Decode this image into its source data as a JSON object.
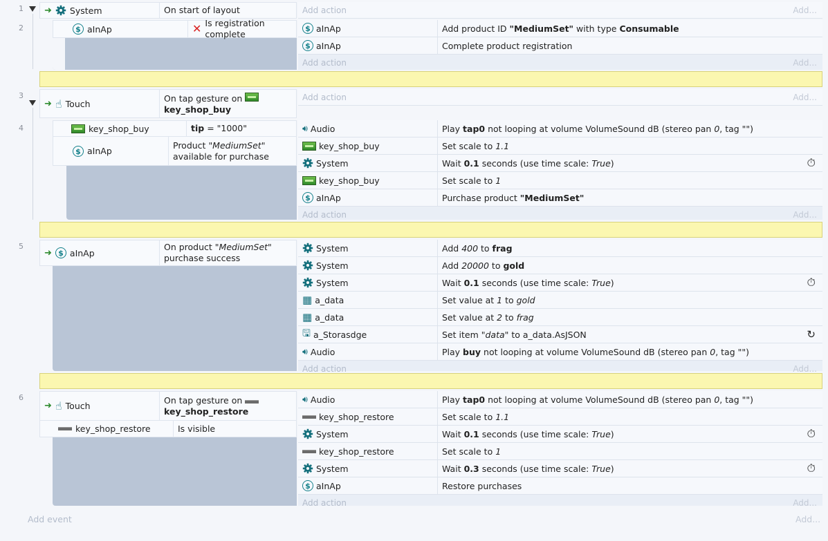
{
  "ui": {
    "add_action": "Add action",
    "add_short": "Add...",
    "add_event": "Add event",
    "timer_icon": "stopwatch-icon",
    "loop_icon": "refresh-icon"
  },
  "events": [
    {
      "num": "1",
      "obj": "System",
      "cond": "On start of layout"
    },
    {
      "num": "2",
      "sub": {
        "obj": "aInAp",
        "cond": "Is registration complete"
      },
      "actions": [
        {
          "obj": "aInAp",
          "pre": "Add product ID ",
          "b1": "\"MediumSet\"",
          "mid": " with type ",
          "b2": "Consumable"
        },
        {
          "obj": "aInAp",
          "text": "Complete product registration"
        }
      ]
    },
    {
      "num": "3",
      "obj": "Touch",
      "cond_pre": "On tap gesture on",
      "cond_obj": "key_shop_buy"
    },
    {
      "num": "4",
      "conds": [
        {
          "obj": "key_shop_buy",
          "b": "tip",
          "rest": " = \"1000\""
        },
        {
          "obj": "aInAp",
          "l1_pre": "Product ",
          "l1_i": "\"MediumSet\"",
          "l2": "available for purchase"
        }
      ],
      "actions": [
        {
          "obj": "Audio",
          "p1": "Play ",
          "b1": "tap0",
          "p2": " not looping at volume VolumeSound dB (stereo pan ",
          "i1": "0",
          "p3": ", tag \"\")"
        },
        {
          "obj": "key_shop_buy",
          "p1": "Set scale to ",
          "i1": "1.1"
        },
        {
          "obj": "System",
          "p1": "Wait ",
          "b1": "0.1",
          "p2": " seconds (use time scale: ",
          "i1": "True",
          "p3": ")"
        },
        {
          "obj": "key_shop_buy",
          "p1": "Set scale to ",
          "i1": "1"
        },
        {
          "obj": "aInAp",
          "p1": "Purchase product ",
          "b1": "\"MediumSet\""
        }
      ]
    },
    {
      "num": "5",
      "obj": "aInAp",
      "l1_pre": "On product ",
      "l1_i": "\"MediumSet\"",
      "l2": "purchase success",
      "actions": [
        {
          "obj": "System",
          "p1": "Add ",
          "i1": "400",
          "p2": " to ",
          "b1": "frag"
        },
        {
          "obj": "System",
          "p1": "Add ",
          "i1": "20000",
          "p2": " to ",
          "b1": "gold"
        },
        {
          "obj": "System",
          "p1": "Wait ",
          "b1": "0.1",
          "p2": " seconds (use time scale: ",
          "i1": "True",
          "p3": ")"
        },
        {
          "obj": "a_data",
          "p1": "Set value at ",
          "i1": "1",
          "p2": " to ",
          "i2": "gold"
        },
        {
          "obj": "a_data",
          "p1": "Set value at ",
          "i1": "2",
          "p2": " to ",
          "i2": "frag"
        },
        {
          "obj": "a_Storasdge",
          "p1": "Set item ",
          "i1": "\"data\"",
          "p2": " to a_data.AsJSON"
        },
        {
          "obj": "Audio",
          "p1": "Play ",
          "b1": "buy",
          "p2": " not looping at volume VolumeSound dB (stereo pan ",
          "i1": "0",
          "p3": ", tag \"\")"
        }
      ]
    },
    {
      "num": "6",
      "obj": "Touch",
      "cond_pre": "On tap gesture on",
      "cond_obj": "key_shop_restore",
      "cond2_obj": "key_shop_restore",
      "cond2": "Is visible",
      "actions": [
        {
          "obj": "Audio",
          "p1": "Play ",
          "b1": "tap0",
          "p2": " not looping at volume VolumeSound dB (stereo pan ",
          "i1": "0",
          "p3": ", tag \"\")"
        },
        {
          "obj": "key_shop_restore",
          "p1": "Set scale to ",
          "i1": "1.1"
        },
        {
          "obj": "System",
          "p1": "Wait ",
          "b1": "0.1",
          "p2": " seconds (use time scale: ",
          "i1": "True",
          "p3": ")"
        },
        {
          "obj": "key_shop_restore",
          "p1": "Set scale to ",
          "i1": "1"
        },
        {
          "obj": "System",
          "p1": "Wait ",
          "b1": "0.3",
          "p2": " seconds (use time scale: ",
          "i1": "True",
          "p3": ")"
        },
        {
          "obj": "aInAp",
          "text": "Restore purchases"
        }
      ]
    }
  ]
}
